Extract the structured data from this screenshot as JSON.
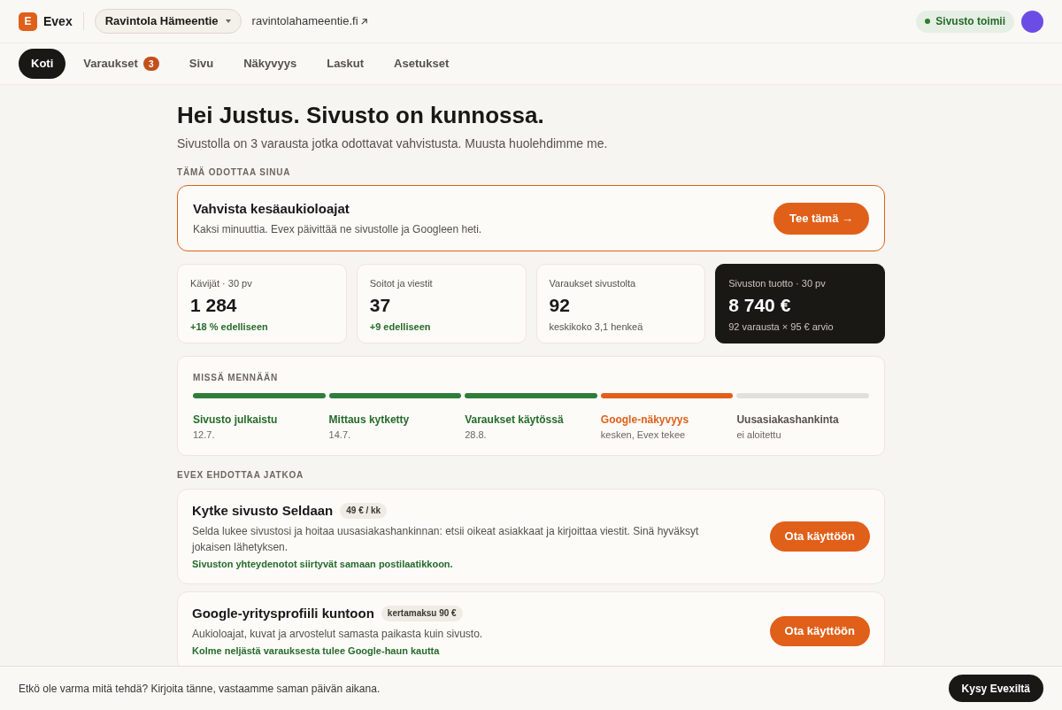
{
  "header": {
    "logo_letter": "E",
    "brand": "Evex",
    "site_selector": "Ravintola Hämeentie",
    "site_link": "ravintolahameentie.fi",
    "status": {
      "label": "Sivusto toimii",
      "color": "#2e7d32"
    }
  },
  "tabs": [
    {
      "label": "Koti",
      "selected": true
    },
    {
      "label": "Varaukset",
      "selected": false,
      "badge": "3"
    },
    {
      "label": "Sivu",
      "selected": false
    },
    {
      "label": "Näkyvyys",
      "selected": false
    },
    {
      "label": "Laskut",
      "selected": false
    },
    {
      "label": "Asetukset",
      "selected": false
    }
  ],
  "greeting": {
    "title": "Hei Justus. Sivusto on kunnossa.",
    "subtitle": "Sivustolla on 3 varausta jotka odottavat vahvistusta. Muusta huolehdimme me."
  },
  "todo": {
    "heading": "TÄMÄ ODOTTAA SINUA",
    "title": "Vahvista kesäaukioloajat",
    "text": "Kaksi minuuttia. Evex päivittää ne sivustolle ja Googleen heti.",
    "button": "Tee tämä →"
  },
  "stats": [
    {
      "label": "Kävijät · 30 pv",
      "value": "1 284",
      "note": "+18 % edelliseen",
      "kind": "positive"
    },
    {
      "label": "Soitot ja viestit",
      "value": "37",
      "note": "+9 edelliseen",
      "kind": "positive"
    },
    {
      "label": "Varaukset sivustolta",
      "value": "92",
      "note": "keskikoko 3,1 henkeä",
      "kind": "neutral"
    },
    {
      "label": "Sivuston tuotto · 30 pv",
      "value": "8 740 €",
      "note": "92 varausta × 95 € arvio",
      "kind": "highlight"
    }
  ],
  "progress": {
    "heading": "MISSÄ MENNÄÄN",
    "steps": [
      {
        "title": "Sivusto julkaistu",
        "detail": "12.7.",
        "kind": "done"
      },
      {
        "title": "Mittaus kytketty",
        "detail": "14.7.",
        "kind": "done"
      },
      {
        "title": "Varaukset käytössä",
        "detail": "28.8.",
        "kind": "done"
      },
      {
        "title": "Google-näkyvyys",
        "detail": "kesken, Evex tekee",
        "kind": "active"
      },
      {
        "title": "Uusasiakashankinta",
        "detail": "ei aloitettu",
        "kind": "todo"
      }
    ]
  },
  "suggestions": {
    "heading": "EVEX EHDOTTAA JATKOA",
    "items": [
      {
        "title": "Kytke sivusto Seldaan",
        "price": "49 € / kk",
        "text": "Selda lukee sivustosi ja hoitaa uusasiakashankinnan: etsii oikeat asiakkaat ja kirjoittaa viestit. Sinä hyväksyt jokaisen lähetyksen.",
        "note": "Sivuston yhteydenotot siirtyvät samaan postilaatikkoon.",
        "button": "Ota käyttöön"
      },
      {
        "title": "Google-yritysprofiili kuntoon",
        "price": "kertamaksu 90 €",
        "text": "Aukioloajat, kuvat ja arvostelut samasta paikasta kuin sivusto.",
        "note": "Kolme neljästä varauksesta tulee Google-haun kautta",
        "button": "Ota käyttöön"
      }
    ]
  },
  "footer": {
    "text": "Etkö ole varma mitä tehdä? Kirjoita tänne, vastaamme saman päivän aikana.",
    "button": "Kysy Evexiltä"
  }
}
